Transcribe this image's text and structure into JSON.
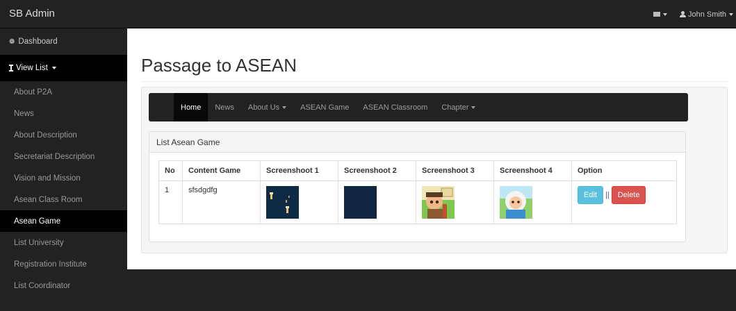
{
  "brand": "SB Admin",
  "topbar": {
    "user_label": "John Smith"
  },
  "sidebar": {
    "dashboard": "Dashboard",
    "view_list": "View List",
    "items": [
      "About P2A",
      "News",
      "About Description",
      "Secretariat Description",
      "Vision and Mission",
      "Asean Class Room",
      "Asean Game",
      "List University",
      "Registration Institute",
      "List Coordinator"
    ],
    "active_item": "Asean Game"
  },
  "page": {
    "title": "Passage to ASEAN"
  },
  "inner_nav": {
    "items": [
      "Home",
      "News",
      "About Us",
      "ASEAN Game",
      "ASEAN Classroom",
      "Chapter"
    ],
    "active": "Home"
  },
  "panel": {
    "heading": "List Asean Game"
  },
  "table": {
    "headers": [
      "No",
      "Content Game",
      "Screenshoot 1",
      "Screenshoot 2",
      "Screenshoot 3",
      "Screenshoot 4",
      "Option"
    ],
    "rows": [
      {
        "no": "1",
        "content_game": "sfsdgdfg"
      }
    ],
    "edit_label": "Edit",
    "separator": "||",
    "delete_label": "Delete"
  },
  "colors": {
    "navbar": "#222222",
    "edit": "#5bc0de",
    "delete": "#d9534f"
  }
}
